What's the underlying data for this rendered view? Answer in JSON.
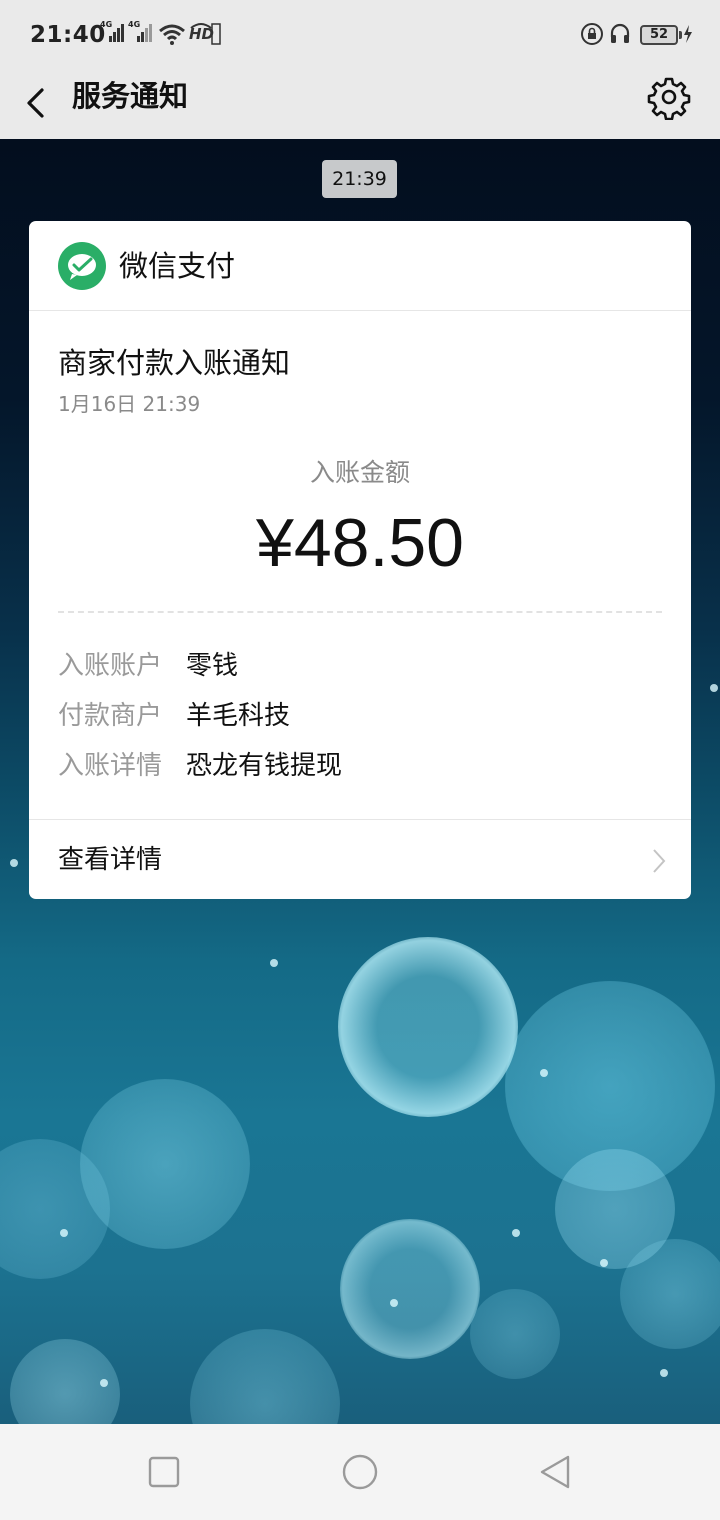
{
  "status_bar": {
    "time": "21:40",
    "signal1_label": "4G",
    "signal2_label": "4G",
    "hd_label": "HD",
    "battery_level": "52",
    "icons": [
      "signal-4g-icon",
      "signal-4g-icon",
      "wifi-icon",
      "hd-voice-icon",
      "rotation-lock-icon",
      "headset-icon",
      "battery-icon",
      "charging-icon"
    ]
  },
  "header": {
    "title": "服务通知",
    "icons": [
      "back-arrow-icon",
      "gear-icon"
    ]
  },
  "chat": {
    "timestamp": "21:39",
    "card": {
      "source_name": "微信支付",
      "source_icon": "wechat-pay-icon",
      "source_color": "#2aae67",
      "title": "商家付款入账通知",
      "date": "1月16日  21:39",
      "amount_label": "入账金额",
      "amount": "¥48.50",
      "details": [
        {
          "key": "入账账户",
          "value": "零钱"
        },
        {
          "key": "付款商户",
          "value": "羊毛科技"
        },
        {
          "key": "入账详情",
          "value": "恐龙有钱提现"
        }
      ],
      "view_details_label": "查看详情"
    }
  },
  "system_nav": {
    "icons": [
      "recents-square-icon",
      "home-circle-icon",
      "back-triangle-icon"
    ]
  }
}
